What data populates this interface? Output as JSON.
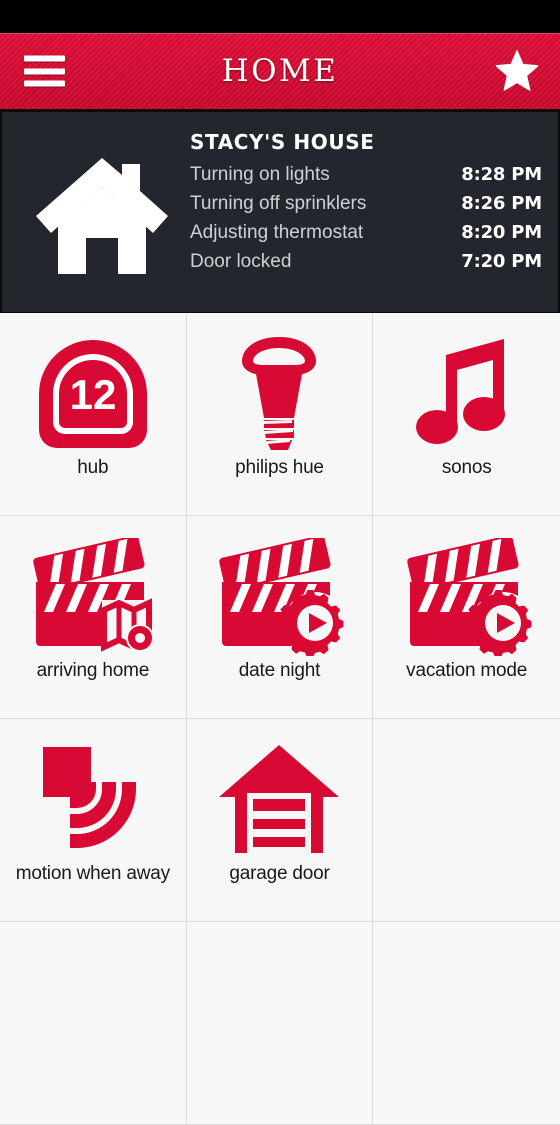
{
  "colors": {
    "brand_red": "#d80a33",
    "header_red": "#e4103a",
    "panel_dark": "#24262e",
    "tile_bg": "#f7f7f7",
    "grid_line": "#dcdcdc",
    "status_bar": "#000000"
  },
  "header": {
    "title": "HOME",
    "menu_icon": "hamburger-menu-icon",
    "favorite_icon": "star-icon"
  },
  "activity": {
    "house_icon": "house-icon",
    "house_name": "STACY'S HOUSE",
    "events": [
      {
        "label": "Turning on lights",
        "time": "8:28 PM"
      },
      {
        "label": "Turning off sprinklers",
        "time": "8:26 PM"
      },
      {
        "label": "Adjusting thermostat",
        "time": "8:20 PM"
      },
      {
        "label": "Door locked",
        "time": "7:20 PM"
      }
    ]
  },
  "grid": {
    "tiles": [
      {
        "label": "hub",
        "icon": "hub-icon",
        "badge": "12"
      },
      {
        "label": "philips hue",
        "icon": "lightbulb-icon"
      },
      {
        "label": "sonos",
        "icon": "music-note-icon"
      },
      {
        "label": "arriving home",
        "icon": "clapperboard-map-icon"
      },
      {
        "label": "date night",
        "icon": "clapperboard-gear-icon"
      },
      {
        "label": "vacation mode",
        "icon": "clapperboard-gear-icon"
      },
      {
        "label": "motion when away",
        "icon": "motion-sensor-icon"
      },
      {
        "label": "garage door",
        "icon": "garage-door-icon"
      },
      {
        "label": "",
        "icon": ""
      },
      {
        "label": "",
        "icon": ""
      },
      {
        "label": "",
        "icon": ""
      },
      {
        "label": "",
        "icon": ""
      }
    ]
  }
}
